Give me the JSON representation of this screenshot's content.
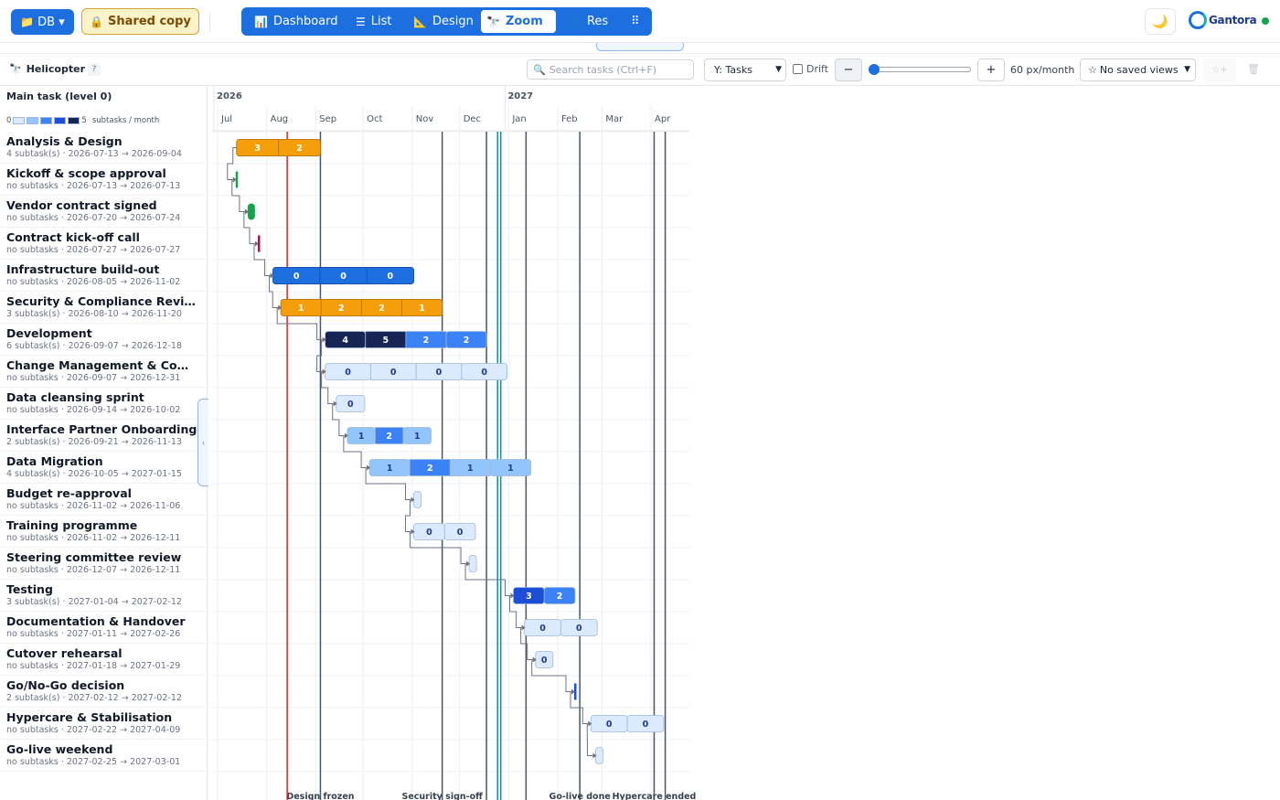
{
  "topbar": {
    "db_label": "DB ▾",
    "shared_label": "Shared copy",
    "tabs": [
      {
        "label": "Dashboard",
        "icon": "chart-icon",
        "glyph": "📊"
      },
      {
        "label": "List",
        "icon": "list-icon",
        "glyph": "☰"
      },
      {
        "label": "Design",
        "icon": "ruler-icon",
        "glyph": "📐"
      },
      {
        "label": "Zoom",
        "icon": "telescope-icon",
        "glyph": "🔭"
      },
      {
        "label": "Res",
        "icon": "person-icon",
        "glyph": "👤"
      }
    ],
    "active_tab": "Zoom",
    "grid_glyph": "⠿",
    "theme_glyph": "🌙",
    "brand": "Gantora",
    "brand_color": "#1d6fe0"
  },
  "toolbar": {
    "title": "Helicopter",
    "help": "?",
    "search_placeholder": "Search tasks (Ctrl+F)",
    "y_select": "Y: Tasks",
    "drift_label": "Drift",
    "zoom_value": "60 px/month",
    "zoom_fraction": 0.0,
    "views_label": "No saved views",
    "star_plus": "☆+"
  },
  "panel": {
    "header": "Main task (level 0)",
    "legend_min": "0",
    "legend_max": "5",
    "legend_unit": "subtasks / month",
    "legend_colors": [
      "#dbeafe",
      "#93c5fd",
      "#3b82f6",
      "#1d4ed8",
      "#172554"
    ]
  },
  "timeline": {
    "start": "2026-07-01",
    "years": [
      {
        "label": "2026",
        "date": "2026-07-01"
      },
      {
        "label": "2027",
        "date": "2027-01-01"
      }
    ],
    "months": [
      {
        "label": "Jul",
        "date": "2026-07-01"
      },
      {
        "label": "Aug",
        "date": "2026-08-01"
      },
      {
        "label": "Sep",
        "date": "2026-09-01"
      },
      {
        "label": "Oct",
        "date": "2026-10-01"
      },
      {
        "label": "Nov",
        "date": "2026-11-01"
      },
      {
        "label": "Dec",
        "date": "2026-12-01"
      },
      {
        "label": "Jan",
        "date": "2027-01-01"
      },
      {
        "label": "Feb",
        "date": "2027-02-01"
      },
      {
        "label": "Mar",
        "date": "2027-03-01"
      },
      {
        "label": "Apr",
        "date": "2027-04-01"
      }
    ],
    "today": "2026-08-14",
    "today_color": "#dc2626",
    "markers": [
      {
        "label": "Design frozen",
        "date": "2026-09-04"
      },
      {
        "label": "Security sign-off",
        "date": "2026-11-20"
      },
      {
        "label": "",
        "date": "2026-12-18"
      },
      {
        "label": "",
        "date": "2026-12-25"
      },
      {
        "label": "",
        "date": "2026-12-27"
      },
      {
        "label": "",
        "date": "2027-01-12"
      },
      {
        "label": "Go-live done",
        "date": "2027-02-15"
      },
      {
        "label": "Hypercare ended",
        "date": "2027-04-03"
      },
      {
        "label": "",
        "date": "2027-04-10"
      }
    ]
  },
  "tasks": [
    {
      "name": "Analysis & Design",
      "meta": "4 subtask(s) · 2026-07-13 → 2026-09-04",
      "start": "2026-07-13",
      "end": "2026-09-04",
      "kind": "group",
      "color": "#f59e0b",
      "segs": [
        "3",
        "2"
      ]
    },
    {
      "name": "Kickoff & scope approval",
      "meta": "no subtasks · 2026-07-13 → 2026-07-13",
      "start": "2026-07-13",
      "end": "2026-07-13",
      "kind": "milestone",
      "color": "#16a34a"
    },
    {
      "name": "Vendor contract signed",
      "meta": "no subtasks · 2026-07-20 → 2026-07-24",
      "start": "2026-07-20",
      "end": "2026-07-24",
      "kind": "pill",
      "color": "#16a34a"
    },
    {
      "name": "Contract kick-off call",
      "meta": "no subtasks · 2026-07-27 → 2026-07-27",
      "start": "2026-07-27",
      "end": "2026-07-27",
      "kind": "milestone",
      "color": "#9d174d"
    },
    {
      "name": "Infrastructure build-out",
      "meta": "no subtasks · 2026-08-05 → 2026-11-02",
      "start": "2026-08-05",
      "end": "2026-11-02",
      "kind": "bar",
      "color": "#1d6fe0",
      "segs": [
        "0",
        "0",
        "0"
      ]
    },
    {
      "name": "Security & Compliance Review",
      "meta": "3 subtask(s) · 2026-08-10 → 2026-11-20",
      "start": "2026-08-10",
      "end": "2026-11-20",
      "kind": "group",
      "color": "#f59e0b",
      "segs": [
        "1",
        "2",
        "2",
        "1"
      ]
    },
    {
      "name": "Development",
      "meta": "6 subtask(s) · 2026-09-07 → 2026-12-18",
      "start": "2026-09-07",
      "end": "2026-12-18",
      "kind": "heat",
      "segs": [
        "4",
        "5",
        "2",
        "2"
      ]
    },
    {
      "name": "Change Management & Communication",
      "meta": "no subtasks · 2026-09-07 → 2026-12-31",
      "start": "2026-09-07",
      "end": "2026-12-31",
      "kind": "heat",
      "segs": [
        "0",
        "0",
        "0",
        "0"
      ]
    },
    {
      "name": "Data cleansing sprint",
      "meta": "no subtasks · 2026-09-14 → 2026-10-02",
      "start": "2026-09-14",
      "end": "2026-10-02",
      "kind": "heat",
      "segs": [
        "0"
      ]
    },
    {
      "name": "Interface Partner Onboarding",
      "meta": "2 subtask(s) · 2026-09-21 → 2026-11-13",
      "start": "2026-09-21",
      "end": "2026-11-13",
      "kind": "heat",
      "segs": [
        "1",
        "2",
        "1"
      ]
    },
    {
      "name": "Data Migration",
      "meta": "4 subtask(s) · 2026-10-05 → 2027-01-15",
      "start": "2026-10-05",
      "end": "2027-01-15",
      "kind": "heat",
      "segs": [
        "1",
        "2",
        "1",
        "1"
      ]
    },
    {
      "name": "Budget re-approval",
      "meta": "no subtasks · 2026-11-02 → 2026-11-06",
      "start": "2026-11-02",
      "end": "2026-11-06",
      "kind": "heat",
      "segs": [
        ""
      ]
    },
    {
      "name": "Training programme",
      "meta": "no subtasks · 2026-11-02 → 2026-12-11",
      "start": "2026-11-02",
      "end": "2026-12-11",
      "kind": "heat",
      "segs": [
        "0",
        "0"
      ]
    },
    {
      "name": "Steering committee review",
      "meta": "no subtasks · 2026-12-07 → 2026-12-11",
      "start": "2026-12-07",
      "end": "2026-12-11",
      "kind": "heat",
      "segs": [
        ""
      ]
    },
    {
      "name": "Testing",
      "meta": "3 subtask(s) · 2027-01-04 → 2027-02-12",
      "start": "2027-01-04",
      "end": "2027-02-12",
      "kind": "heat",
      "segs": [
        "3",
        "2"
      ]
    },
    {
      "name": "Documentation & Handover",
      "meta": "no subtasks · 2027-01-11 → 2027-02-26",
      "start": "2027-01-11",
      "end": "2027-02-26",
      "kind": "heat",
      "segs": [
        "0",
        "0"
      ]
    },
    {
      "name": "Cutover rehearsal",
      "meta": "no subtasks · 2027-01-18 → 2027-01-29",
      "start": "2027-01-18",
      "end": "2027-01-29",
      "kind": "heat",
      "segs": [
        "0"
      ]
    },
    {
      "name": "Go/No-Go decision",
      "meta": "2 subtask(s) · 2027-02-12 → 2027-02-12",
      "start": "2027-02-12",
      "end": "2027-02-12",
      "kind": "milestone",
      "color": "#1d4ed8"
    },
    {
      "name": "Hypercare & Stabilisation",
      "meta": "no subtasks · 2027-02-22 → 2027-04-09",
      "start": "2027-02-22",
      "end": "2027-04-09",
      "kind": "heat",
      "segs": [
        "0",
        "0"
      ]
    },
    {
      "name": "Go-live weekend",
      "meta": "no subtasks · 2027-02-25 → 2027-03-01",
      "start": "2027-02-25",
      "end": "2027-03-01",
      "kind": "heat",
      "segs": [
        ""
      ]
    }
  ],
  "dependencies": [
    [
      0,
      1
    ],
    [
      1,
      2
    ],
    [
      2,
      3
    ],
    [
      3,
      4
    ],
    [
      4,
      5
    ],
    [
      5,
      6
    ],
    [
      6,
      7
    ],
    [
      7,
      8
    ],
    [
      8,
      9
    ],
    [
      9,
      10
    ],
    [
      10,
      11
    ],
    [
      11,
      12
    ],
    [
      12,
      13
    ],
    [
      13,
      14
    ],
    [
      14,
      15
    ],
    [
      15,
      16
    ],
    [
      16,
      17
    ],
    [
      17,
      18
    ],
    [
      18,
      19
    ]
  ]
}
